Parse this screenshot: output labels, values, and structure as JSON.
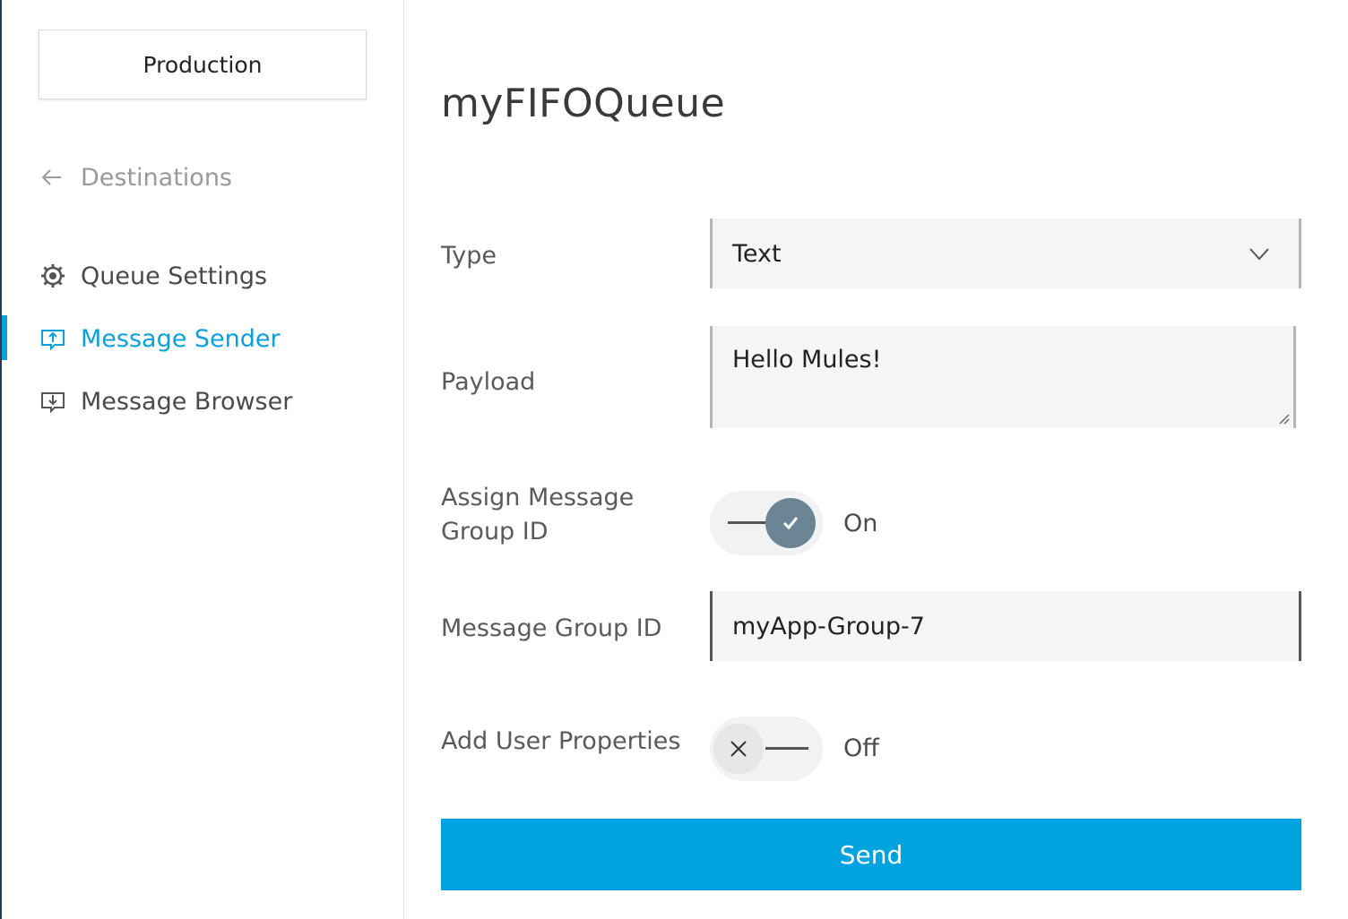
{
  "sidebar": {
    "environment_label": "Production",
    "back_label": "Destinations",
    "items": [
      {
        "label": "Queue Settings",
        "icon": "gear-icon",
        "active": false
      },
      {
        "label": "Message Sender",
        "icon": "send-message-icon",
        "active": true
      },
      {
        "label": "Message Browser",
        "icon": "browse-messages-icon",
        "active": false
      }
    ]
  },
  "main": {
    "title": "myFIFOQueue",
    "type": {
      "label": "Type",
      "value": "Text"
    },
    "payload": {
      "label": "Payload",
      "value": "Hello Mules!"
    },
    "assign_group": {
      "label": "Assign Message Group ID",
      "state_text": "On",
      "on": true
    },
    "group_id": {
      "label": "Message Group ID",
      "value": "myApp-Group-7"
    },
    "user_props": {
      "label": "Add User Properties",
      "state_text": "Off",
      "on": false
    },
    "send_label": "Send"
  },
  "colors": {
    "accent": "#00a2df",
    "active_nav": "#0ba0dc",
    "toggle_knob_on": "#6b8595",
    "toggle_knob_off": "#e6e6e6"
  }
}
